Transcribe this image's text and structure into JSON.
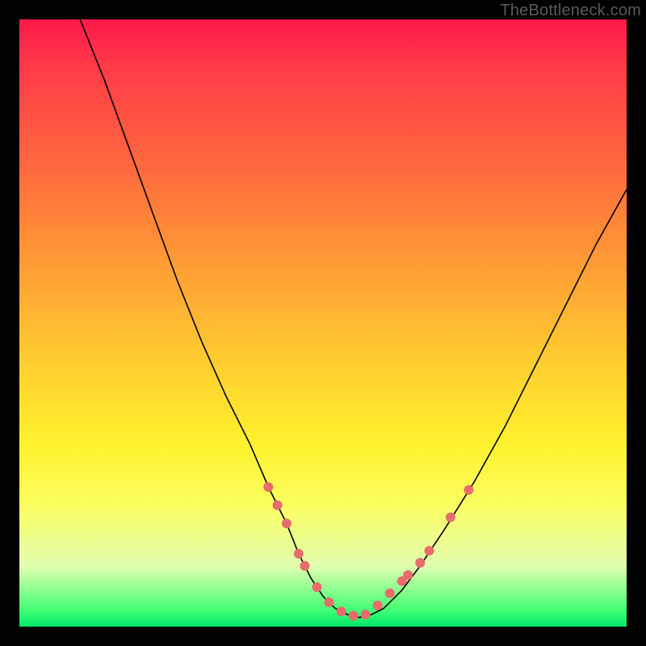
{
  "watermark": "TheBottleneck.com",
  "chart_data": {
    "type": "line",
    "title": "",
    "xlabel": "",
    "ylabel": "",
    "xlim": [
      0,
      100
    ],
    "ylim": [
      0,
      100
    ],
    "grid": false,
    "series": [
      {
        "name": "curve",
        "color": "#000000",
        "x": [
          10,
          14,
          18,
          22,
          26,
          30,
          34,
          38,
          41,
          44,
          46,
          48,
          50,
          52,
          54,
          56,
          58,
          60,
          63,
          66,
          70,
          75,
          80,
          85,
          90,
          95,
          100
        ],
        "y": [
          100,
          90,
          79,
          68,
          57,
          47,
          38,
          30,
          23,
          17,
          12,
          8,
          5,
          3,
          2,
          1.5,
          2,
          3,
          6,
          10,
          16,
          24,
          33,
          43,
          53,
          63,
          72
        ]
      }
    ],
    "markers": {
      "name": "highlight-dots",
      "color": "#e86c6c",
      "radius": 6,
      "points": [
        {
          "x": 41,
          "y": 23
        },
        {
          "x": 42.5,
          "y": 20
        },
        {
          "x": 44,
          "y": 17
        },
        {
          "x": 46,
          "y": 12
        },
        {
          "x": 47,
          "y": 10
        },
        {
          "x": 49,
          "y": 6.5
        },
        {
          "x": 51,
          "y": 4
        },
        {
          "x": 53,
          "y": 2.5
        },
        {
          "x": 55,
          "y": 1.8
        },
        {
          "x": 57,
          "y": 2
        },
        {
          "x": 59,
          "y": 3.5
        },
        {
          "x": 61,
          "y": 5.5
        },
        {
          "x": 63,
          "y": 7.5
        },
        {
          "x": 64,
          "y": 8.5
        },
        {
          "x": 66,
          "y": 10.5
        },
        {
          "x": 67.5,
          "y": 12.5
        },
        {
          "x": 71,
          "y": 18
        },
        {
          "x": 74,
          "y": 22.5
        }
      ]
    },
    "background_gradient": {
      "direction": "vertical",
      "stops": [
        {
          "pos": 0.0,
          "color": "#ff1a4a"
        },
        {
          "pos": 0.25,
          "color": "#ff6b3d"
        },
        {
          "pos": 0.55,
          "color": "#ffc930"
        },
        {
          "pos": 0.8,
          "color": "#fcff62"
        },
        {
          "pos": 1.0,
          "color": "#00e86a"
        }
      ]
    }
  }
}
